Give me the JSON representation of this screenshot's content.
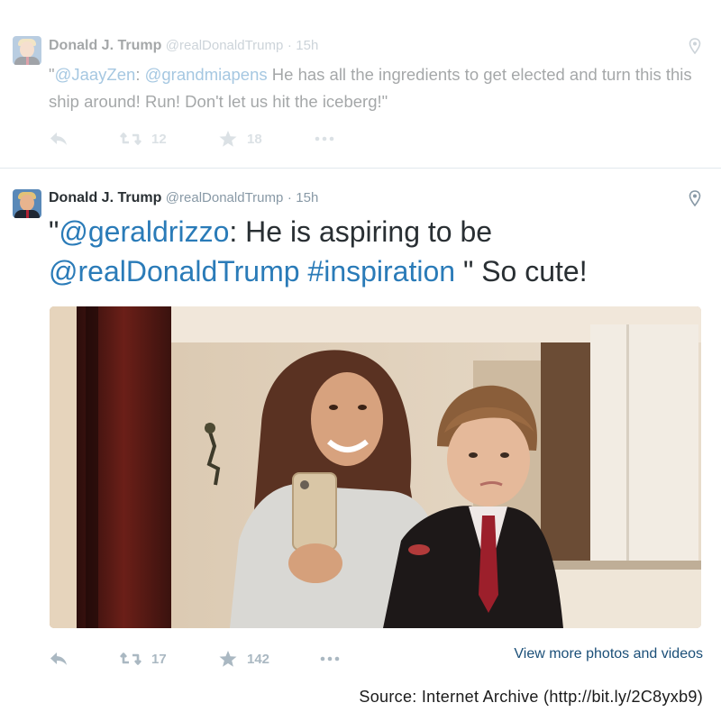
{
  "tweets": [
    {
      "author": {
        "name": "Donald J. Trump",
        "handle": "@realDonaldTrump",
        "time": "15h"
      },
      "text_segments": {
        "q1": "\"",
        "m1": "@JaayZen",
        "t1": ": ",
        "m2": "@grandmiapens",
        "t2": " He has all the ingredients to get elected and turn this this ship around! Run! Don't let us hit the iceberg!\""
      },
      "actions": {
        "retweets": "12",
        "favorites": "18"
      }
    },
    {
      "author": {
        "name": "Donald J. Trump",
        "handle": "@realDonaldTrump",
        "time": "15h"
      },
      "text_segments": {
        "q1": "\"",
        "m1": "@geraldrizzo",
        "t1": ": He is aspiring to be ",
        "m2": "@realDonaldTrump",
        "t2": " ",
        "m3": "#inspiration",
        "t3": " \"  So cute!"
      },
      "actions": {
        "retweets": "17",
        "favorites": "142"
      },
      "view_more": "View more photos and videos"
    }
  ],
  "separator": "·",
  "source": "Source: Internet Archive (http://bit.ly/2C8yxb9)",
  "icons": [
    "avatar",
    "location-pin-icon",
    "reply-icon",
    "retweet-icon",
    "favorite-star-icon",
    "more-dots-icon"
  ],
  "colors": {
    "link": "#2a7bb8",
    "muted": "#8899a6",
    "action": "#aab8c2",
    "text": "#292f33"
  }
}
